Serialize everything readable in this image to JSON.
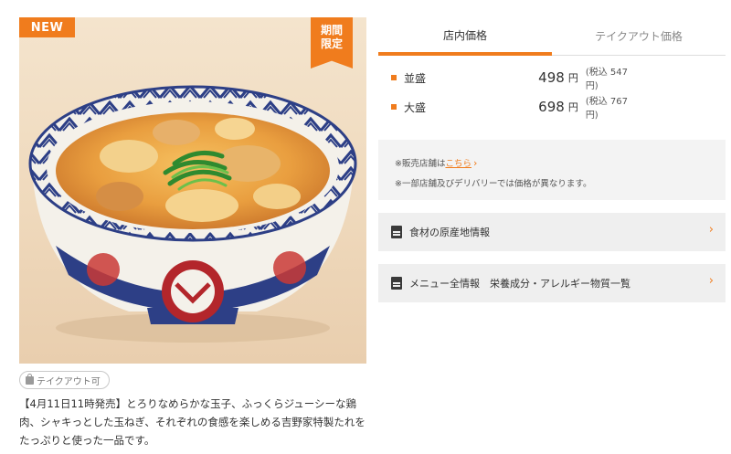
{
  "badges": {
    "new_label": "NEW",
    "limited_line1": "期間",
    "limited_line2": "限定"
  },
  "takeout_tag": {
    "label": "テイクアウト可"
  },
  "description": "【4月11日11時発売】とろりなめらかな玉子、ふっくらジューシーな鶏肉、シャキっとした玉ねぎ、それぞれの食感を楽しめる吉野家特製たれをたっぷりと使った一品です。",
  "tabs": [
    {
      "label": "店内価格",
      "active": true
    },
    {
      "label": "テイクアウト価格",
      "active": false
    }
  ],
  "prices": [
    {
      "size": "並盛",
      "price": "498",
      "unit": "円",
      "tax": "(税込 547 円)"
    },
    {
      "size": "大盛",
      "price": "698",
      "unit": "円",
      "tax": "(税込 767 円)"
    }
  ],
  "notice": {
    "prefix": "※販売店舗は",
    "link": "こちら",
    "note": "※一部店舗及びデリバリーでは価格が異なります。"
  },
  "accordions": [
    {
      "label": "食材の原産地情報"
    },
    {
      "label": "メニュー全情報　栄養成分・アレルギー物質一覧"
    }
  ],
  "colors": {
    "accent": "#f07c1d",
    "panel_bg": "#efefef",
    "text": "#333333"
  }
}
